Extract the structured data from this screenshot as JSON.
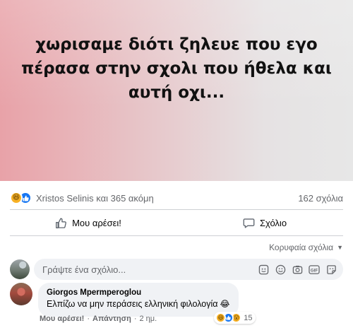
{
  "post": {
    "text": "χωρισαμε διότι ζηλευε που εγο πέρασα στην σχολι που ήθελα και αυτή οχι...",
    "gradient_start": "#e8a2a8",
    "gradient_end": "#e7e7e7"
  },
  "reactions": {
    "icons": [
      "haha",
      "like"
    ],
    "summary": "Xristos Selinis και 365 ακόμη",
    "comment_count": "162 σχόλια"
  },
  "actions": {
    "like_label": "Μου αρέσει!",
    "comment_label": "Σχόλιο"
  },
  "sort": {
    "label": "Κορυφαία σχόλια"
  },
  "composer": {
    "placeholder": "Γράψτε ένα σχόλιο...",
    "tools": [
      "sticker-icon",
      "emoji-icon",
      "camera-icon",
      "gif-icon",
      "sticker-alt-icon"
    ]
  },
  "comment": {
    "author": "Giorgos Mpermperoglou",
    "text": "Ελπίζω να μην περάσεις ελληνική φιλολογία",
    "emoji": "😂",
    "reaction_icons": [
      "haha",
      "like",
      "wow"
    ],
    "reaction_count": "15",
    "like_label": "Μου αρέσει!",
    "reply_label": "Απάντηση",
    "time": "2 ημ."
  },
  "colors": {
    "accent": "#1877f2",
    "secondary_text": "#65676b",
    "bubble_bg": "#f0f2f5",
    "divider": "#ced0d4"
  }
}
